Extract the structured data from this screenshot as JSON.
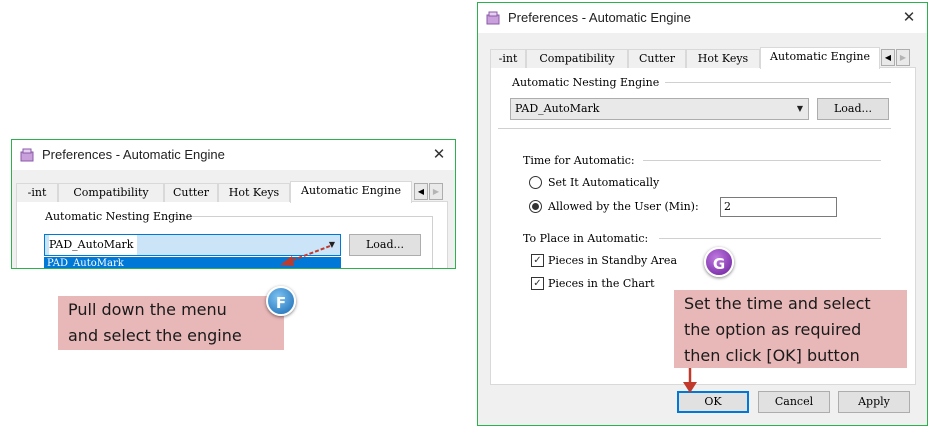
{
  "dialog": {
    "title": "Preferences - Automatic Engine",
    "close_glyph": "✕",
    "tabs": [
      "Print",
      "Compatibility",
      "Cutter",
      "Hot Keys",
      "Automatic Engine"
    ],
    "tabs_visible": [
      "-int",
      "Compatibility",
      "Cutter",
      "Hot Keys",
      "Automatic Engine"
    ],
    "tab_prev_glyph": "◀",
    "tab_next_glyph": "▶",
    "engine_group_label": "Automatic Nesting Engine",
    "engine_value": "PAD_AutoMark",
    "combo_arrow": "▼",
    "load_button": "Load...",
    "time_group_label": "Time for Automatic:",
    "radio_auto": "Set It Automatically",
    "radio_user": "Allowed by the User (Min):",
    "minutes_value": "2",
    "place_group_label": "To Place in Automatic:",
    "check_standby": "Pieces in Standby Area",
    "check_chart": "Pieces in the Chart",
    "check_glyph": "✓",
    "ok_button": "OK",
    "cancel_button": "Cancel",
    "apply_button": "Apply"
  },
  "dropdown": {
    "selected_option": "PAD_AutoMark"
  },
  "annotations": {
    "callout_f": [
      "Pull down the menu",
      "and select the engine"
    ],
    "badge_f": "F",
    "callout_g": [
      "Set the time and select",
      "the option as required",
      "then click [OK] button"
    ],
    "badge_g": "G"
  },
  "colors": {
    "window_border": "#2bb24c",
    "selection_blue": "#0078d7",
    "callout_bg": "#e8b7b8",
    "arrow_red": "#c0392b"
  }
}
